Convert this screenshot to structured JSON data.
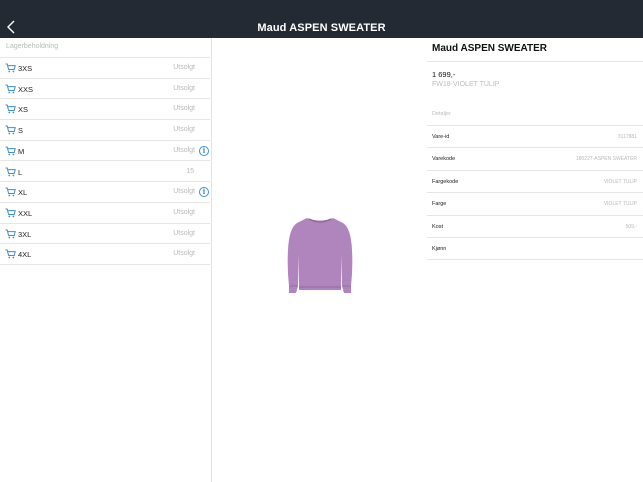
{
  "header": {
    "title": "Maud ASPEN SWEATER"
  },
  "stock": {
    "header": "Lagerbeholdning",
    "rows": [
      {
        "size": "3XS",
        "status": "Utsolgt",
        "info": false
      },
      {
        "size": "XXS",
        "status": "Utsolgt",
        "info": false
      },
      {
        "size": "XS",
        "status": "Utsolgt",
        "info": false
      },
      {
        "size": "S",
        "status": "Utsolgt",
        "info": false
      },
      {
        "size": "M",
        "status": "Utsolgt",
        "info": true
      },
      {
        "size": "L",
        "status": "15",
        "info": false
      },
      {
        "size": "XL",
        "status": "Utsolgt",
        "info": true
      },
      {
        "size": "XXL",
        "status": "Utsolgt",
        "info": false
      },
      {
        "size": "3XL",
        "status": "Utsolgt",
        "info": false
      },
      {
        "size": "4XL",
        "status": "Utsolgt",
        "info": false
      }
    ]
  },
  "product": {
    "title": "Maud ASPEN SWEATER",
    "price": "1 699,-",
    "subtitle": "FW18-VIOLET TULIP",
    "image_color": "#b085be",
    "details_header": "Detaljer",
    "details": [
      {
        "key": "Vare-id",
        "value": "3117881"
      },
      {
        "key": "Varekode",
        "value": "180227-ASPEN SWEATER"
      },
      {
        "key": "Fargekode",
        "value": "VIOLET TULIP"
      },
      {
        "key": "Farge",
        "value": "VIOLET TULIP"
      },
      {
        "key": "Kost",
        "value": "509,-"
      },
      {
        "key": "Kjønn",
        "value": ""
      }
    ]
  },
  "colors": {
    "topbar": "#232a33",
    "accent": "#3b8fd4",
    "muted": "#b9b9b9"
  },
  "icons": {
    "back": "chevron-left-icon",
    "cart": "cart-icon",
    "info": "info-icon"
  }
}
